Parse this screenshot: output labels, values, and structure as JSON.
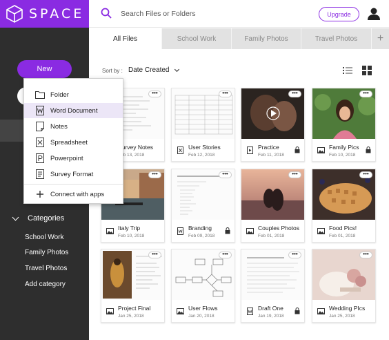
{
  "app": {
    "name": "SPACE",
    "accent": "#8a2be2"
  },
  "search": {
    "placeholder": "Search Files or Folders"
  },
  "topbar": {
    "upgrade_label": "Upgrade"
  },
  "sidebar": {
    "new_label": "New",
    "categories_label": "Categories",
    "categories": [
      "School Work",
      "Family Photos",
      "Travel Photos",
      "Add category"
    ]
  },
  "new_menu": {
    "items": [
      {
        "label": "Folder",
        "icon": "folder-icon"
      },
      {
        "label": "Word Document",
        "icon": "word-doc-icon"
      },
      {
        "label": "Notes",
        "icon": "notes-icon"
      },
      {
        "label": "Spreadsheet",
        "icon": "spreadsheet-icon"
      },
      {
        "label": "Powerpoint",
        "icon": "powerpoint-icon"
      },
      {
        "label": "Survey Format",
        "icon": "survey-icon"
      }
    ],
    "connect_label": "Connect with apps",
    "highlighted": "Word Document"
  },
  "tabs": [
    "All Files",
    "School Work",
    "Family Photos",
    "Travel Photos"
  ],
  "active_tab": "All Files",
  "sort": {
    "label": "Sort by :",
    "value": "Date Created"
  },
  "more_label": "•••",
  "files": [
    {
      "name": "Survey Notes",
      "date": "Feb 13, 2018",
      "type": "doc",
      "locked": false
    },
    {
      "name": "User Stories",
      "date": "Feb 12, 2018",
      "type": "spreadsheet",
      "locked": false
    },
    {
      "name": "Practice",
      "date": "Feb 11, 2018",
      "type": "video",
      "locked": true
    },
    {
      "name": "Family Pics",
      "date": "Feb 10, 2018",
      "type": "image",
      "locked": true
    },
    {
      "name": "Italy Trip",
      "date": "Feb 10, 2018",
      "type": "image",
      "locked": false
    },
    {
      "name": "Branding",
      "date": "Feb 09, 2018",
      "type": "word",
      "locked": true
    },
    {
      "name": "Couples Photos",
      "date": "Feb 01, 2018",
      "type": "image",
      "locked": false
    },
    {
      "name": "Food Pics!",
      "date": "Feb 01, 2018",
      "type": "image",
      "locked": false
    },
    {
      "name": "Project Final",
      "date": "Jan 25, 2018",
      "type": "image",
      "locked": false
    },
    {
      "name": "User Flows",
      "date": "Jan 20, 2018",
      "type": "image",
      "locked": false
    },
    {
      "name": "Draft One",
      "date": "Jan 19, 2018",
      "type": "word",
      "locked": true
    },
    {
      "name": "Wedding PIcs",
      "date": "Jan 25, 2018",
      "type": "image",
      "locked": false
    }
  ]
}
